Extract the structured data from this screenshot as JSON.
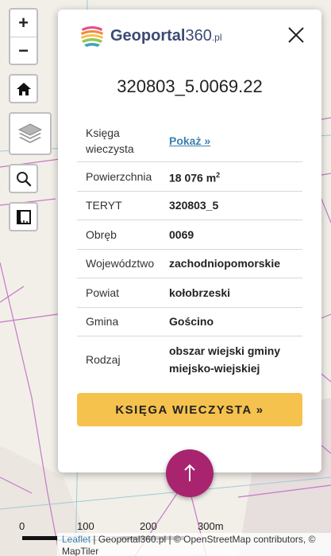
{
  "map": {
    "zoom_in_label": "+",
    "zoom_out_label": "−",
    "scale_labels": [
      "0",
      "100",
      "200",
      "300m"
    ]
  },
  "popup": {
    "logo": {
      "name": "Geoportal",
      "num": "360",
      "tld": ".pl"
    },
    "title": "320803_5.0069.22",
    "rows": [
      {
        "key": "Księga wieczysta",
        "value": "Pokaż »"
      },
      {
        "key": "Powierzchnia",
        "value": "18 076 m",
        "sup": "2"
      },
      {
        "key": "TERYT",
        "value": "320803_5"
      },
      {
        "key": "Obręb",
        "value": "0069"
      },
      {
        "key": "Województwo",
        "value": "zachodniopomorskie"
      },
      {
        "key": "Powiat",
        "value": "kołobrzeski"
      },
      {
        "key": "Gmina",
        "value": "Gościno"
      },
      {
        "key": "Rodzaj",
        "value": "obszar wiejski gminy miejsko-wiejskiej"
      }
    ],
    "button_label": "KSIĘGA WIECZYSTA »"
  },
  "attribution": {
    "leaflet": "Leaflet",
    "rest": " | Geoportal360.pl | © OpenStreetMap contributors, © MapTiler"
  },
  "colors": {
    "brand": "#3d4a74",
    "button": "#f5c24e",
    "fab": "#a8246f",
    "link": "#3c7fb0",
    "parcel_lines": "#c471c4"
  }
}
